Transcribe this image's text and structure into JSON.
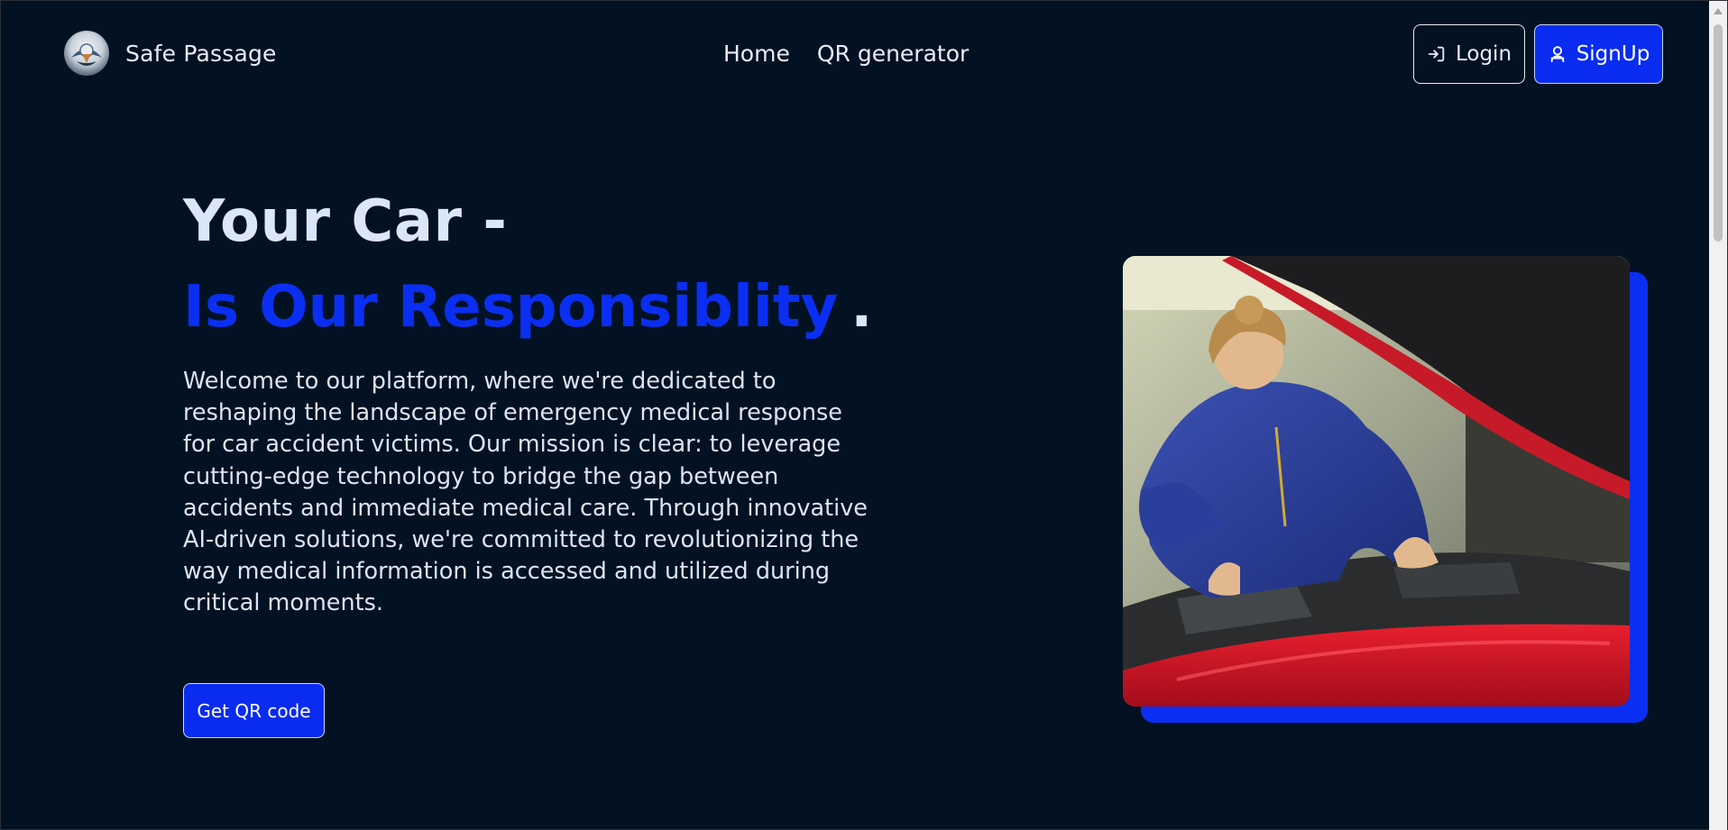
{
  "nav": {
    "brand": "Safe Passage",
    "links": [
      "Home",
      "QR generator"
    ],
    "login_label": "Login",
    "signup_label": "SignUp"
  },
  "hero": {
    "title": "Your Car -",
    "subtitle": "Is Our Responsiblity",
    "subtitle_dot": ".",
    "description": "Welcome to our platform, where we're dedicated to reshaping the landscape of emergency medical response for car accident victims. Our mission is clear: to leverage cutting-edge technology to bridge the gap between accidents and immediate medical care. Through innovative AI-driven solutions, we're committed to revolutionizing the way medical information is accessed and utilized during critical moments.",
    "cta_label": "Get QR code"
  },
  "colors": {
    "background": "#021222",
    "accent": "#0a2ff2",
    "text": "#dbe6fb"
  },
  "icons": {
    "login": "login-arrow-icon",
    "signup": "user-icon",
    "logo": "safe-passage-logo"
  }
}
